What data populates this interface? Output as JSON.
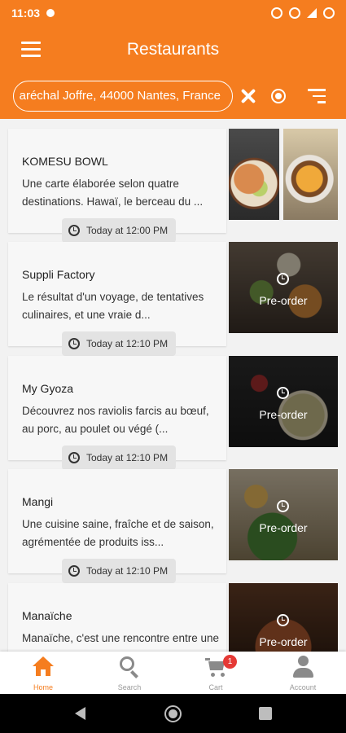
{
  "status": {
    "time": "11:03"
  },
  "header": {
    "title": "Restaurants"
  },
  "search": {
    "address": "aréchal Joffre, 44000 Nantes, France"
  },
  "restaurants": [
    {
      "name": "KOMESU BOWL",
      "description": "Une carte élaborée selon quatre destinations. Hawaï, le berceau du ...",
      "time": "Today at 12:00 PM",
      "preorder": ""
    },
    {
      "name": "Suppli Factory",
      "description": "Le résultat d'un voyage, de tentatives culinaires, et une vraie d...",
      "time": "Today at 12:10 PM",
      "preorder": "Pre-order"
    },
    {
      "name": "My Gyoza",
      "description": "Découvrez nos raviolis farcis au bœuf, au porc, au poulet ou végé (...",
      "time": "Today at 12:10 PM",
      "preorder": "Pre-order"
    },
    {
      "name": "Mangi",
      "description": "Une cuisine saine, fraîche et de saison, agrémentée de produits iss...",
      "time": "Today at 12:10 PM",
      "preorder": "Pre-order"
    },
    {
      "name": "Manaïche",
      "description": "Manaïche, c'est une rencontre entre une Française et un Libanais,...",
      "time": "",
      "preorder": "Pre-order"
    }
  ],
  "bottom_nav": [
    {
      "label": "Home",
      "icon": "home-icon",
      "active": true
    },
    {
      "label": "Search",
      "icon": "search-icon",
      "active": false
    },
    {
      "label": "Cart",
      "icon": "cart-icon",
      "active": false,
      "badge": "1"
    },
    {
      "label": "Account",
      "icon": "account-icon",
      "active": false
    }
  ],
  "colors": {
    "primary": "#f57d1f",
    "badge": "#e53935"
  }
}
